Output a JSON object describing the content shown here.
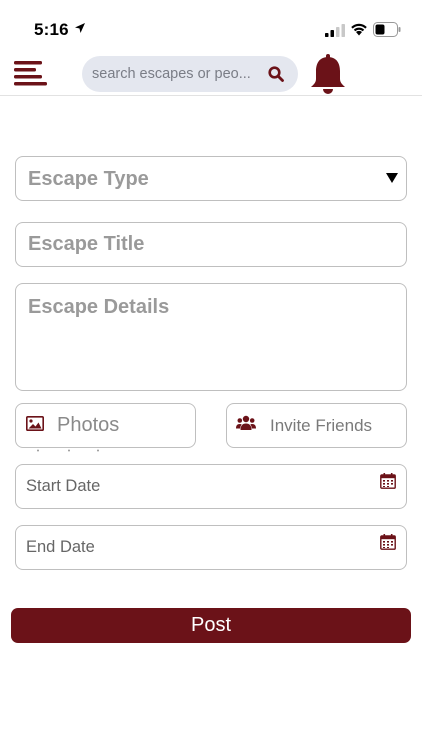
{
  "status_bar": {
    "time": "5:16"
  },
  "header": {
    "search_placeholder": "search escapes or peo..."
  },
  "form": {
    "escape_type_label": "Escape Type",
    "escape_title_label": "Escape Title",
    "escape_details_label": "Escape Details",
    "photos_label": "Photos",
    "invite_friends_label": "Invite Friends",
    "start_date_placeholder": "Start Date",
    "end_date_placeholder": "End Date",
    "post_label": "Post"
  },
  "colors": {
    "brand": "#6b1218",
    "search_bg": "#e4e7ef",
    "border": "#bfbfbf",
    "placeholder": "#9a9a9a"
  },
  "icons": {
    "menu": "menu-icon",
    "search": "search-icon",
    "bell": "bell-icon",
    "dropdown": "caret-down-icon",
    "photos": "image-icon",
    "friends": "users-icon",
    "calendar": "calendar-icon"
  }
}
